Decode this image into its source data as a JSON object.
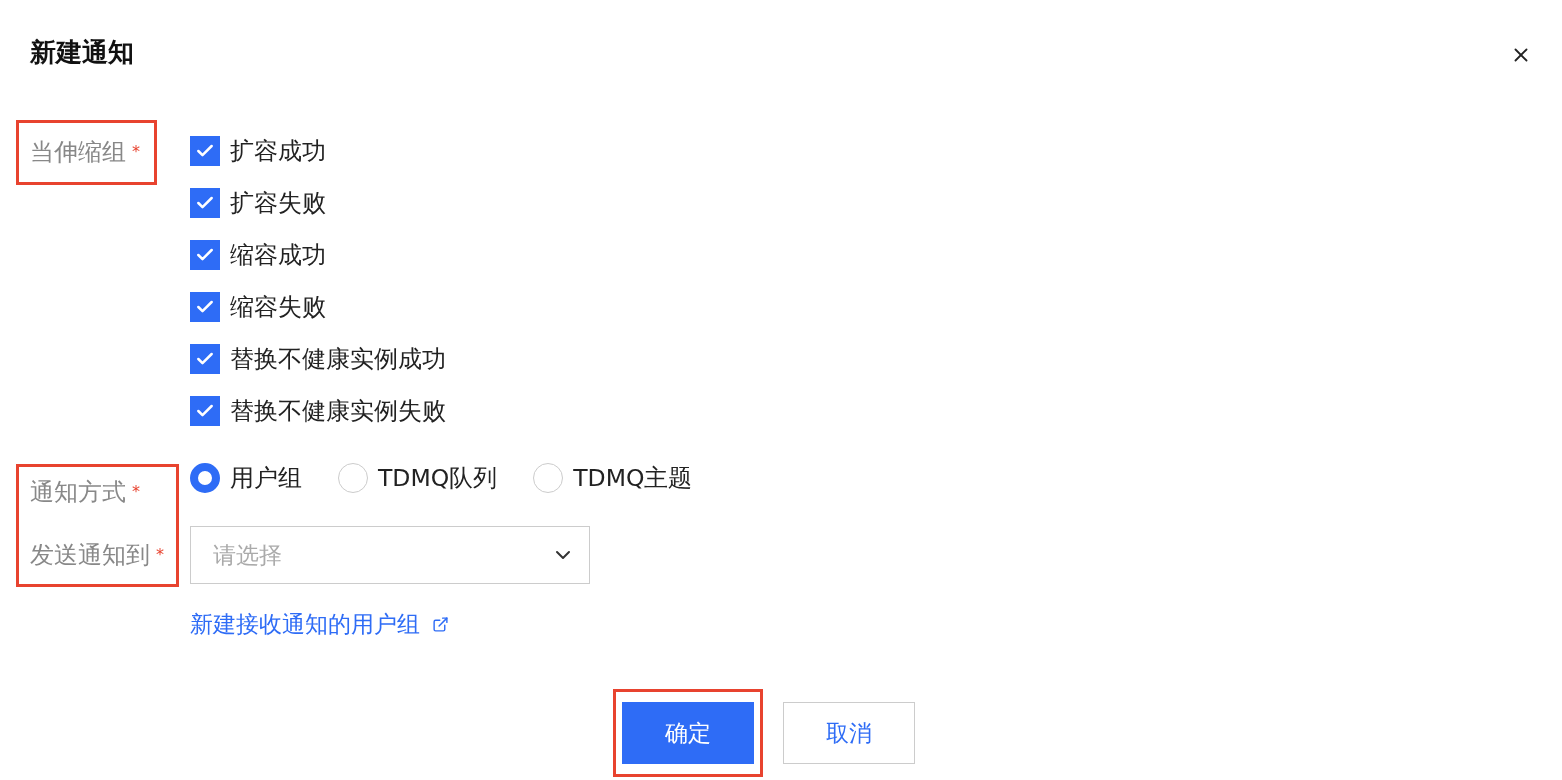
{
  "dialog": {
    "title": "新建通知"
  },
  "trigger": {
    "label": "当伸缩组",
    "required_mark": "*",
    "highlighted": true,
    "options": [
      {
        "label": "扩容成功",
        "checked": true
      },
      {
        "label": "扩容失败",
        "checked": true
      },
      {
        "label": "缩容成功",
        "checked": true
      },
      {
        "label": "缩容失败",
        "checked": true
      },
      {
        "label": "替换不健康实例成功",
        "checked": true
      },
      {
        "label": "替换不健康实例失败",
        "checked": true
      }
    ]
  },
  "notify": {
    "highlighted": true,
    "method": {
      "label": "通知方式",
      "required_mark": "*",
      "options": [
        {
          "label": "用户组",
          "selected": true
        },
        {
          "label": "TDMQ队列",
          "selected": false
        },
        {
          "label": "TDMQ主题",
          "selected": false
        }
      ]
    },
    "target": {
      "label": "发送通知到",
      "required_mark": "*",
      "placeholder": "请选择"
    },
    "link": "新建接收通知的用户组"
  },
  "buttons": [
    {
      "label": "确定",
      "kind": "primary",
      "highlighted": true
    },
    {
      "label": "取消",
      "kind": "secondary",
      "highlighted": false
    }
  ]
}
